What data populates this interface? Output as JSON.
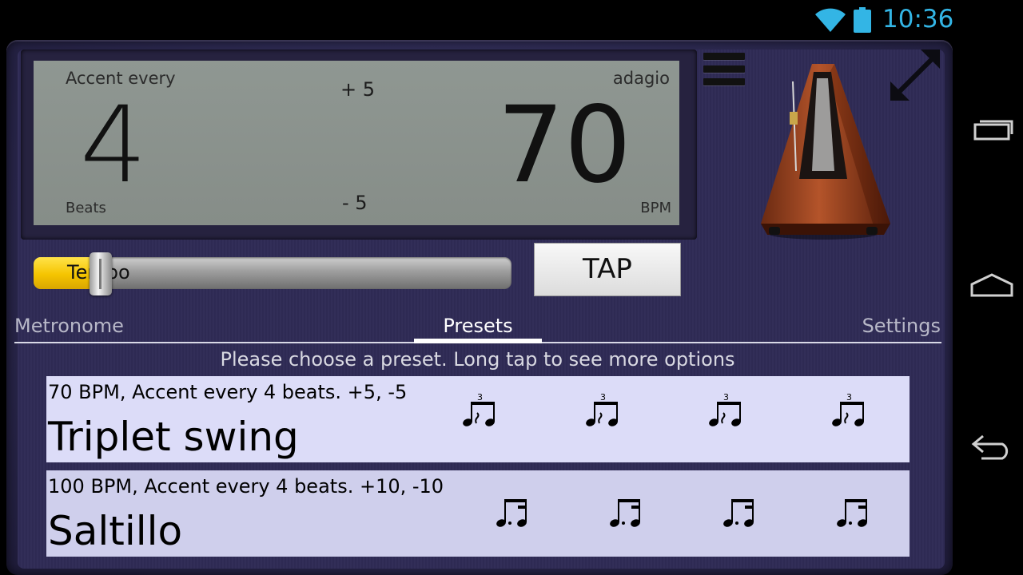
{
  "status_bar": {
    "time": "10:36",
    "wifi_icon": "wifi-icon",
    "battery_icon": "battery-icon",
    "accent_color": "#33b5e5"
  },
  "display": {
    "accent_label": "Accent every",
    "beats_value": "4",
    "beats_label": "Beats",
    "plus_label": "+ 5",
    "minus_label": "- 5",
    "tempo_mode": "adagio",
    "bpm_value": "70",
    "bpm_label": "BPM"
  },
  "controls": {
    "menu_icon": "hamburger-menu-icon",
    "expand_icon": "expand-arrows-icon",
    "tempo_label": "Tempo",
    "tempo_level": 0.14,
    "tap_label": "TAP"
  },
  "tabs": [
    {
      "label": "Metronome",
      "selected": false
    },
    {
      "label": "Presets",
      "selected": true
    },
    {
      "label": "Settings",
      "selected": false
    }
  ],
  "hint": "Please choose a preset. Long tap to see more options",
  "presets": [
    {
      "description": "70 BPM, Accent every 4 beats. +5, -5",
      "name": "Triplet swing",
      "rhythm_icon": "triplet-swing-note-icon",
      "count": 4,
      "tuplet_mark": "3"
    },
    {
      "description": "100 BPM, Accent every 4 beats. +10, -10",
      "name": "Saltillo",
      "rhythm_icon": "dotted-eighth-sixteenth-note-icon",
      "count": 4
    }
  ],
  "nav_bar": {
    "icons": [
      "recent-apps-icon",
      "home-icon",
      "back-icon"
    ]
  },
  "colors": {
    "lcd": "#8a928d",
    "frame": "#2f2b55",
    "preset_row": "#dcdcf8",
    "tempo_fill": "#f5c400"
  }
}
